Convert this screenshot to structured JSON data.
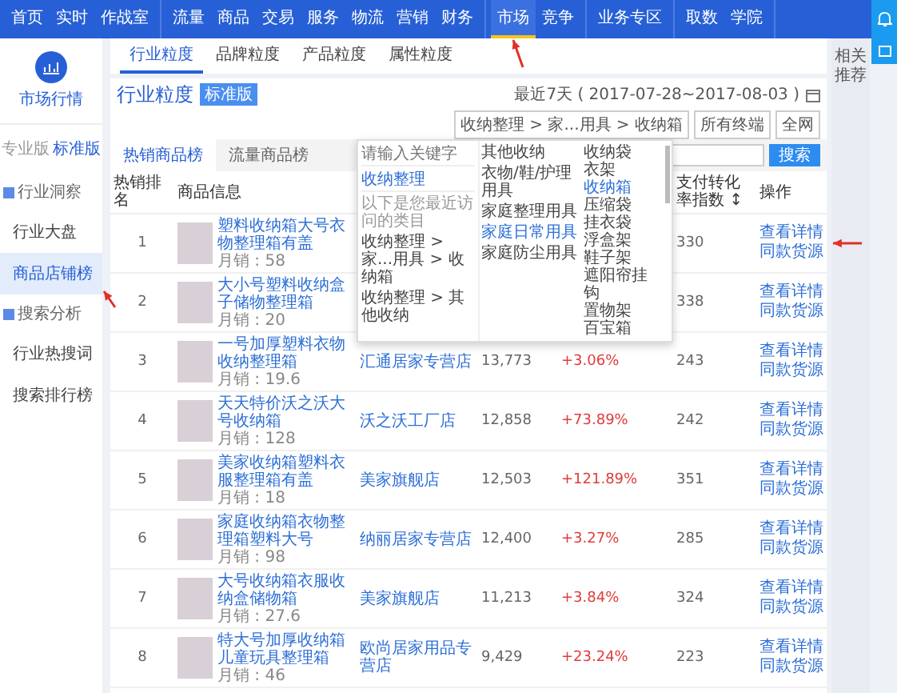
{
  "nav": {
    "groups": [
      {
        "items": [
          {
            "label": "首页",
            "selected": false
          },
          {
            "label": "实时",
            "selected": false
          },
          {
            "label": "作战室",
            "selected": false
          }
        ]
      },
      {
        "items": [
          {
            "label": "流量",
            "selected": false
          },
          {
            "label": "商品",
            "selected": false
          },
          {
            "label": "交易",
            "selected": false
          },
          {
            "label": "服务",
            "selected": false
          },
          {
            "label": "物流",
            "selected": false
          },
          {
            "label": "营销",
            "selected": false
          },
          {
            "label": "财务",
            "selected": false
          }
        ]
      },
      {
        "items": [
          {
            "label": "市场",
            "selected": true
          },
          {
            "label": "竞争",
            "selected": false
          }
        ]
      },
      {
        "items": [
          {
            "label": "业务专区",
            "selected": false
          }
        ]
      },
      {
        "items": [
          {
            "label": "取数",
            "selected": false
          },
          {
            "label": "学院",
            "selected": false
          }
        ]
      }
    ]
  },
  "sidebar": {
    "title": "市场行情",
    "versions": [
      {
        "label": "专业版",
        "selected": false
      },
      {
        "label": "标准版",
        "selected": true
      }
    ],
    "groups": [
      {
        "label": "行业洞察",
        "items": [
          {
            "label": "行业大盘",
            "selected": false
          },
          {
            "label": "商品店铺榜",
            "selected": true
          }
        ]
      },
      {
        "label": "搜索分析",
        "items": [
          {
            "label": "行业热搜词",
            "selected": false
          },
          {
            "label": "搜索排行榜",
            "selected": false
          }
        ]
      }
    ]
  },
  "subtabs": [
    {
      "label": "行业粒度",
      "selected": true
    },
    {
      "label": "品牌粒度",
      "selected": false
    },
    {
      "label": "产品粒度",
      "selected": false
    },
    {
      "label": "属性粒度",
      "selected": false
    }
  ],
  "header": {
    "title": "行业粒度",
    "badge": "标准版",
    "date": "最近7天 ( 2017-07-28~2017-08-03 )",
    "category": "收纳整理 > 家...用具 > 收纳箱",
    "terminal": "所有终端",
    "scope": "全网"
  },
  "ranking_tabs": [
    {
      "label": "热销商品榜",
      "selected": true
    },
    {
      "label": "流量商品榜",
      "selected": false
    }
  ],
  "search_button": "搜索",
  "category_dropdown": {
    "placeholder": "请输入关键字",
    "current": "收纳整理",
    "recent_title": "以下是您最近访问的类目",
    "recent": [
      "收纳整理 > 家...用具 > 收纳箱",
      "收纳整理 > 其他收纳"
    ],
    "level2": [
      {
        "label": "其他收纳",
        "selected": false
      },
      {
        "label": "衣物/鞋/护理用具",
        "selected": false
      },
      {
        "label": "家庭整理用具",
        "selected": false
      },
      {
        "label": "家庭日常用具",
        "selected": true
      },
      {
        "label": "家庭防尘用具",
        "selected": false
      }
    ],
    "level3": [
      {
        "label": "收纳袋",
        "selected": false
      },
      {
        "label": "衣架",
        "selected": false
      },
      {
        "label": "收纳箱",
        "selected": true
      },
      {
        "label": "压缩袋",
        "selected": false
      },
      {
        "label": "挂衣袋",
        "selected": false
      },
      {
        "label": "浮盒架",
        "selected": false
      },
      {
        "label": "鞋子架",
        "selected": false
      },
      {
        "label": "遮阳帘挂钩",
        "selected": false
      },
      {
        "label": "置物架",
        "selected": false
      },
      {
        "label": "百宝箱",
        "selected": false
      }
    ]
  },
  "table": {
    "columns": [
      {
        "label": "热销排名"
      },
      {
        "label": "商品信息"
      },
      {},
      {},
      {},
      {
        "label": "支付转化率指数 ↕"
      },
      {
        "label": "操作"
      }
    ],
    "rows": [
      {
        "rank": "1",
        "title": "塑料收纳箱大号衣物整理箱有盖",
        "sales": "月销 : 58",
        "rate": "330",
        "actions": [
          "查看详情",
          "同款货源"
        ]
      },
      {
        "rank": "2",
        "title": "大小号塑料收纳盒子储物整理箱",
        "sales": "月销 : 20",
        "rate": "338",
        "actions": [
          "查看详情",
          "同款货源"
        ]
      },
      {
        "rank": "3",
        "title": "一号加厚塑料衣物收纳整理箱",
        "sales": "月销 : 19.6",
        "shop": "汇通居家专营店",
        "index": "13,773",
        "growth": "+3.06%",
        "rate": "243",
        "actions": [
          "查看详情",
          "同款货源"
        ]
      },
      {
        "rank": "4",
        "title": "天天特价沃之沃大号收纳箱",
        "sales": "月销 : 128",
        "shop": "沃之沃工厂店",
        "index": "12,858",
        "growth": "+73.89%",
        "rate": "242",
        "actions": [
          "查看详情",
          "同款货源"
        ]
      },
      {
        "rank": "5",
        "title": "美家收纳箱塑料衣服整理箱有盖",
        "sales": "月销 : 18",
        "shop": "美家旗舰店",
        "index": "12,503",
        "growth": "+121.89%",
        "rate": "351",
        "actions": [
          "查看详情",
          "同款货源"
        ]
      },
      {
        "rank": "6",
        "title": "家庭收纳箱衣物整理箱塑料大号",
        "sales": "月销 : 98",
        "shop": "纳丽居家专营店",
        "index": "12,400",
        "growth": "+3.27%",
        "rate": "285",
        "actions": [
          "查看详情",
          "同款货源"
        ]
      },
      {
        "rank": "7",
        "title": "大号收纳箱衣服收纳盒储物箱",
        "sales": "月销 : 27.6",
        "shop": "美家旗舰店",
        "index": "11,213",
        "growth": "+3.84%",
        "rate": "324",
        "actions": [
          "查看详情",
          "同款货源"
        ]
      },
      {
        "rank": "8",
        "title": "特大号加厚收纳箱儿童玩具整理箱",
        "sales": "月销 : 46",
        "shop": "欧尚居家用品专营店",
        "index": "9,429",
        "growth": "+23.24%",
        "rate": "223",
        "actions": [
          "查看详情",
          "同款货源"
        ]
      }
    ]
  },
  "side_note": "相关推荐"
}
